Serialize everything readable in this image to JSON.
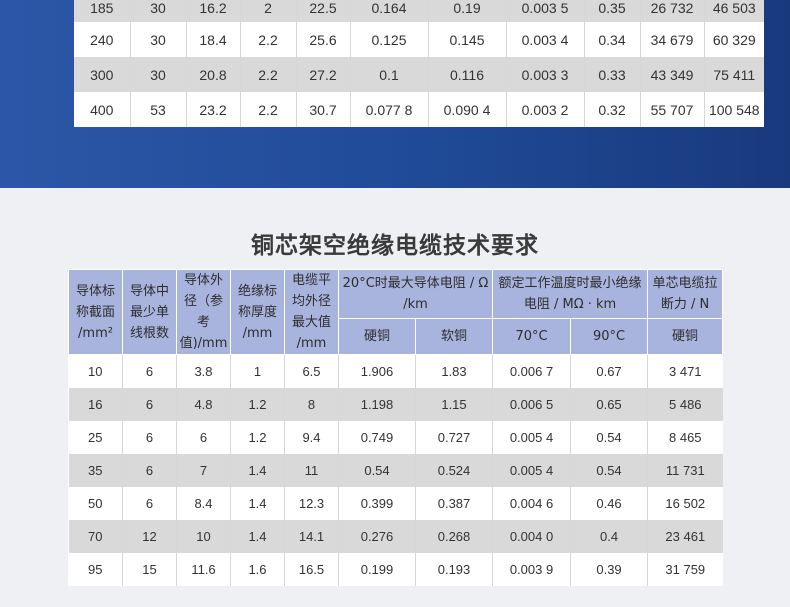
{
  "top_table": {
    "rows": [
      [
        "185",
        "30",
        "16.2",
        "2",
        "22.5",
        "0.164",
        "0.19",
        "0.003 5",
        "0.35",
        "26 732",
        "46 503"
      ],
      [
        "240",
        "30",
        "18.4",
        "2.2",
        "25.6",
        "0.125",
        "0.145",
        "0.003 4",
        "0.34",
        "34 679",
        "60 329"
      ],
      [
        "300",
        "30",
        "20.8",
        "2.2",
        "27.2",
        "0.1",
        "0.116",
        "0.003 3",
        "0.33",
        "43 349",
        "75 411"
      ],
      [
        "400",
        "53",
        "23.2",
        "2.2",
        "30.7",
        "0.077 8",
        "0.090 4",
        "0.003 2",
        "0.32",
        "55 707",
        "100 548"
      ]
    ]
  },
  "section": {
    "title": "铜芯架空绝缘电缆技术要求"
  },
  "main_table": {
    "headers": {
      "col1": [
        "导体标",
        "称截面",
        "/mm²"
      ],
      "col2": [
        "导体中",
        "最少单",
        "线根数"
      ],
      "col3": [
        "导体外",
        "径（参考",
        "值)/mm"
      ],
      "col4": [
        "绝缘标",
        "称厚度",
        "/mm"
      ],
      "col5": [
        "电缆平",
        "均外径",
        "最大值",
        "/mm"
      ],
      "group_resistance": [
        "20°C时最大导体电阻 / Ω",
        "/km"
      ],
      "group_insulation": [
        "额定工作温度时最小绝缘",
        "电阻 / MΩ · km"
      ],
      "group_tensile": [
        "单芯电缆拉",
        "断力 / N"
      ],
      "sub_hard": "硬铜",
      "sub_soft": "软铜",
      "sub_70": "70°C",
      "sub_90": "90°C",
      "sub_hard2": "硬铜"
    },
    "rows": [
      [
        "10",
        "6",
        "3.8",
        "1",
        "6.5",
        "1.906",
        "1.83",
        "0.006 7",
        "0.67",
        "3 471"
      ],
      [
        "16",
        "6",
        "4.8",
        "1.2",
        "8",
        "1.198",
        "1.15",
        "0.006 5",
        "0.65",
        "5 486"
      ],
      [
        "25",
        "6",
        "6",
        "1.2",
        "9.4",
        "0.749",
        "0.727",
        "0.005 4",
        "0.54",
        "8 465"
      ],
      [
        "35",
        "6",
        "7",
        "1.4",
        "11",
        "0.54",
        "0.524",
        "0.005 4",
        "0.54",
        "11 731"
      ],
      [
        "50",
        "6",
        "8.4",
        "1.4",
        "12.3",
        "0.399",
        "0.387",
        "0.004 6",
        "0.46",
        "16 502"
      ],
      [
        "70",
        "12",
        "10",
        "1.4",
        "14.1",
        "0.276",
        "0.268",
        "0.004 0",
        "0.4",
        "23 461"
      ],
      [
        "95",
        "15",
        "11.6",
        "1.6",
        "16.5",
        "0.199",
        "0.193",
        "0.003 9",
        "0.39",
        "31 759"
      ]
    ]
  }
}
